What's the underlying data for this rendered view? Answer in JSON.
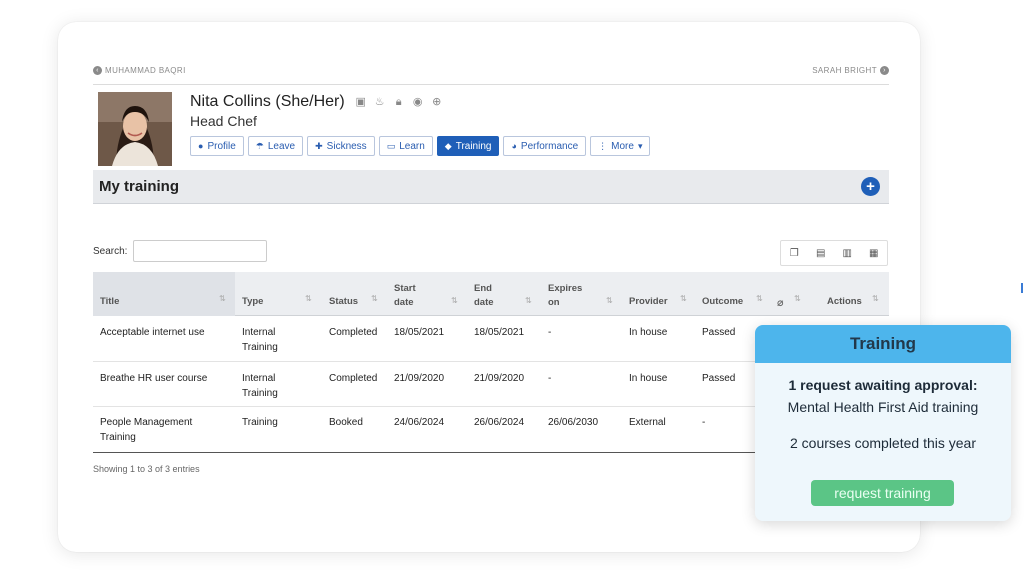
{
  "nav": {
    "prev_name": "MUHAMMAD BAQRI",
    "next_name": "SARAH BRIGHT"
  },
  "employee": {
    "name": "Nita Collins (She/Her)",
    "role": "Head Chef",
    "status_icons": [
      "briefcase-icon",
      "flame-icon",
      "lock-icon",
      "eye-icon",
      "globe-icon"
    ]
  },
  "tabs": [
    {
      "label": "Profile",
      "icon": "user-icon",
      "active": false
    },
    {
      "label": "Leave",
      "icon": "umbrella-icon",
      "active": false
    },
    {
      "label": "Sickness",
      "icon": "medical-kit-icon",
      "active": false
    },
    {
      "label": "Learn",
      "icon": "laptop-icon",
      "active": false
    },
    {
      "label": "Training",
      "icon": "graduation-cap-icon",
      "active": true
    },
    {
      "label": "Performance",
      "icon": "gauge-icon",
      "active": false
    },
    {
      "label": "More",
      "icon": "vertical-dots-icon",
      "active": false
    }
  ],
  "section": {
    "title": "My training"
  },
  "search": {
    "label": "Search:",
    "value": ""
  },
  "table": {
    "headers": {
      "title": "Title",
      "type": "Type",
      "status": "Status",
      "start_1": "Start",
      "start_2": "date",
      "end_1": "End",
      "end_2": "date",
      "expires_1": "Expires",
      "expires_2": "on",
      "provider": "Provider",
      "outcome": "Outcome",
      "actions": "Actions"
    },
    "rows": [
      {
        "title_1": "Acceptable internet use",
        "title_2": "",
        "type_1": "Internal",
        "type_2": "Training",
        "status": "Completed",
        "start": "18/05/2021",
        "end": "18/05/2021",
        "expires": "-",
        "provider": "In house",
        "outcome": "Passed"
      },
      {
        "title_1": "Breathe HR user course",
        "title_2": "",
        "type_1": "Internal",
        "type_2": "Training",
        "status": "Completed",
        "start": "21/09/2020",
        "end": "21/09/2020",
        "expires": "-",
        "provider": "In house",
        "outcome": "Passed"
      },
      {
        "title_1": "People Management",
        "title_2": "Training",
        "type_1": "Training",
        "type_2": "",
        "status": "Booked",
        "start": "24/06/2024",
        "end": "26/06/2024",
        "expires": "26/06/2030",
        "provider": "External",
        "outcome": "-"
      }
    ],
    "footer": "Showing 1 to 3 of 3 entries"
  },
  "popup": {
    "title": "Training",
    "line1": "1 request awaiting approval:",
    "line2": "Mental Health First Aid training",
    "line3": "2 courses completed this year",
    "button": "request training",
    "button_color": "#5bc586",
    "header_color": "#4db5ec"
  },
  "colors": {
    "primary": "#1f5fb8"
  }
}
